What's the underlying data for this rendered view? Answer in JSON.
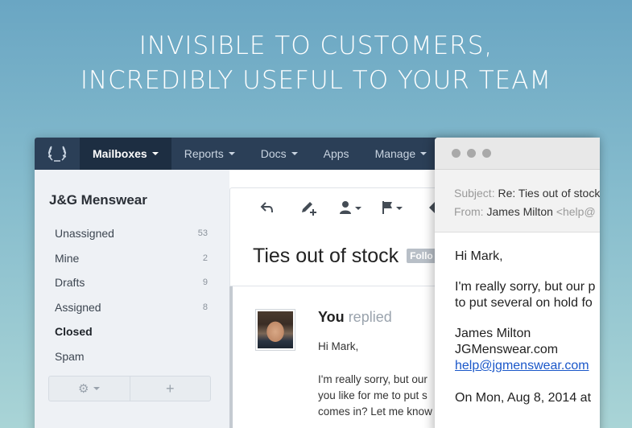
{
  "headline": {
    "line1": "INVISIBLE TO CUSTOMERS,",
    "line2": "INCREDIBLY USEFUL TO YOUR TEAM"
  },
  "navbar": {
    "items": [
      {
        "label": "Mailboxes",
        "dropdown": true,
        "active": true
      },
      {
        "label": "Reports",
        "dropdown": true
      },
      {
        "label": "Docs",
        "dropdown": true
      },
      {
        "label": "Apps",
        "dropdown": false
      },
      {
        "label": "Manage",
        "dropdown": true
      }
    ]
  },
  "sidebar": {
    "mailbox_name": "J&G Menswear",
    "folders": [
      {
        "label": "Unassigned",
        "count": "53"
      },
      {
        "label": "Mine",
        "count": "2"
      },
      {
        "label": "Drafts",
        "count": "9"
      },
      {
        "label": "Assigned",
        "count": "8"
      },
      {
        "label": "Closed",
        "count": ""
      },
      {
        "label": "Spam",
        "count": ""
      }
    ],
    "buttons": [
      "gear-icon",
      "plus-icon"
    ]
  },
  "conversation": {
    "toolbar_icons": [
      "reply-icon",
      "note-icon",
      "assign-icon",
      "flag-icon",
      "tag-icon"
    ],
    "subject": "Ties out of stock",
    "tag": "Follo",
    "reply": {
      "who": "You",
      "action": "replied",
      "greeting": "Hi Mark,",
      "line1": "I'm really sorry, but our",
      "line2": "you like for me to put s",
      "line3": "comes in? Let me know"
    }
  },
  "customer_email": {
    "subject_label": "Subject:",
    "subject_value": "Re: Ties out of stock",
    "from_label": "From:",
    "from_name": "James Milton",
    "from_addr": "<help@",
    "greeting": "Hi Mark,",
    "body_line1": "I'm really sorry, but our p",
    "body_line2": "to put several on hold fo",
    "sig_name": "James Milton",
    "sig_company": "JGMenswear.com",
    "sig_email": "help@jgmenswear.com",
    "quote_line": "On Mon, Aug 8, 2014 at"
  },
  "colors": {
    "navbar": "#2b3f57",
    "navbar_active": "#1d2e42",
    "sidebar_bg": "#eef1f5",
    "link": "#1a57c9"
  }
}
